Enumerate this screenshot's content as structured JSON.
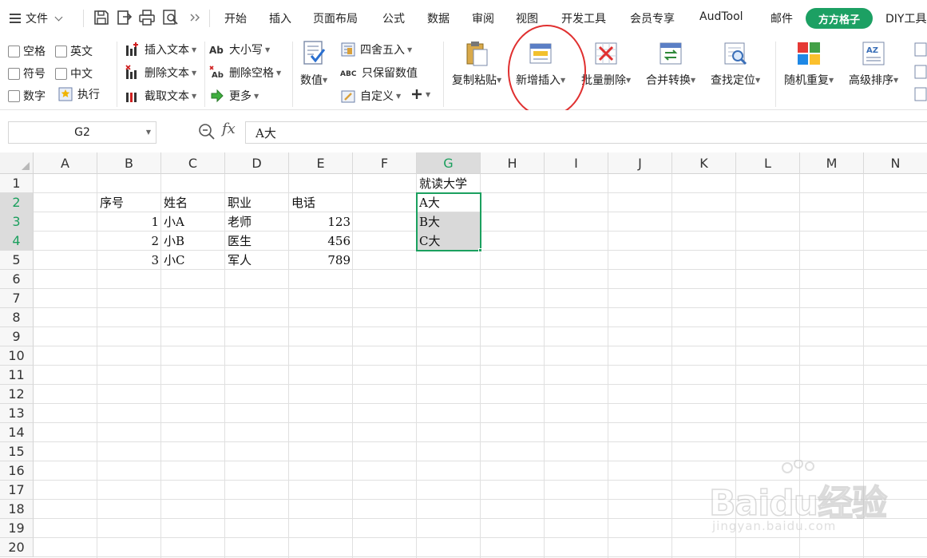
{
  "menubar": {
    "file_label": "文件",
    "tabs": [
      "开始",
      "插入",
      "页面布局",
      "公式",
      "数据",
      "审阅",
      "视图",
      "开发工具",
      "会员专享",
      "AudTool",
      "邮件"
    ],
    "active_tab": "方方格子",
    "overflow_tab": "DIY工具"
  },
  "ribbon": {
    "checkboxes": [
      "空格",
      "英文",
      "符号",
      "中文",
      "数字"
    ],
    "exec_label": "执行",
    "insert_text": "插入文本",
    "delete_text": "删除文本",
    "extract_text": "截取文本",
    "case_label": "大小写",
    "del_space": "删除空格",
    "more_label": "更多",
    "value_label": "数值",
    "round_label": "四舍五入",
    "keep_value": "只保留数值",
    "custom_label": "自定义",
    "copy_paste": "复制粘贴",
    "new_insert": "新增插入",
    "batch_delete": "批量删除",
    "merge_convert": "合并转换",
    "find_locate": "查找定位",
    "random_repeat": "随机重复",
    "adv_sort": "高级排序",
    "ab_icon_text": "Ab",
    "abc_icon_text": "ABC",
    "az_icon_text": "AZ"
  },
  "formula_bar": {
    "name_box": "G2",
    "fx": "fx",
    "formula": "A大"
  },
  "sheet": {
    "columns": [
      "A",
      "B",
      "C",
      "D",
      "E",
      "F",
      "G",
      "H",
      "I",
      "J",
      "K",
      "L",
      "M",
      "N"
    ],
    "rows": [
      "1",
      "2",
      "3",
      "4",
      "5",
      "6",
      "7",
      "8",
      "9",
      "10",
      "11",
      "12",
      "13",
      "14",
      "15",
      "16",
      "17",
      "18",
      "19",
      "20"
    ],
    "selected_column": "G",
    "selected_rows": [
      "2",
      "3",
      "4"
    ],
    "cells": {
      "G1": "就读大学",
      "B2": "序号",
      "C2": "姓名",
      "D2": "职业",
      "E2": "电话",
      "G2": "A大",
      "B3": "1",
      "C3": "小A",
      "D3": "老师",
      "E3": "123",
      "G3": "B大",
      "B4": "2",
      "C4": "小B",
      "D4": "医生",
      "E4": "456",
      "G4": "C大",
      "B5": "3",
      "C5": "小C",
      "D5": "军人",
      "E5": "789"
    }
  },
  "watermark": {
    "brand": "Baidu经验",
    "url": "jingyan.baidu.com"
  },
  "colors": {
    "accent_green": "#1ca063",
    "annotation_red": "#e03030"
  }
}
